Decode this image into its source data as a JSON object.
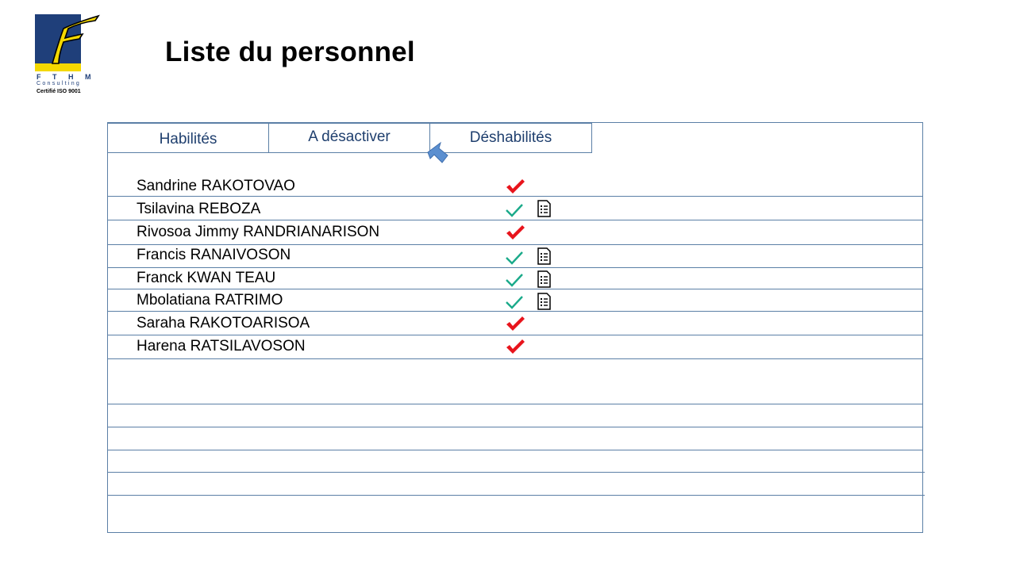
{
  "header": {
    "logo": {
      "letter": "F",
      "name": "F T H M",
      "tagline": "Consulting",
      "certification": "Certifié ISO 9001"
    },
    "title": "Liste du personnel"
  },
  "tabs": [
    {
      "label": "Habilités"
    },
    {
      "label": "A désactiver"
    },
    {
      "label": "Déshabilités"
    }
  ],
  "colors": {
    "border": "#5b7fa6",
    "tab_text": "#1f3f6e",
    "check_red": "#e8141c",
    "check_green": "#1aaa8a",
    "logo_blue": "#1f3f7a",
    "logo_yellow": "#f4d800"
  },
  "rows": [
    {
      "name": "Sandrine RAKOTOVAO",
      "status_icon": "red-check-icon",
      "has_document": false
    },
    {
      "name": "Tsilavina REBOZA",
      "status_icon": "green-check-icon",
      "has_document": true
    },
    {
      "name": "Rivosoa Jimmy RANDRIANARISON",
      "status_icon": "red-check-icon",
      "has_document": false
    },
    {
      "name": "Francis RANAIVOSON",
      "status_icon": "green-check-icon",
      "has_document": true
    },
    {
      "name": "Franck KWAN TEAU",
      "status_icon": "green-check-icon",
      "has_document": true
    },
    {
      "name": "Mbolatiana RATRIMO",
      "status_icon": "green-check-icon",
      "has_document": true
    },
    {
      "name": "Saraha RAKOTOARISOA",
      "status_icon": "red-check-icon",
      "has_document": false
    },
    {
      "name": "Harena RATSILAVOSON",
      "status_icon": "red-check-icon",
      "has_document": false
    }
  ]
}
